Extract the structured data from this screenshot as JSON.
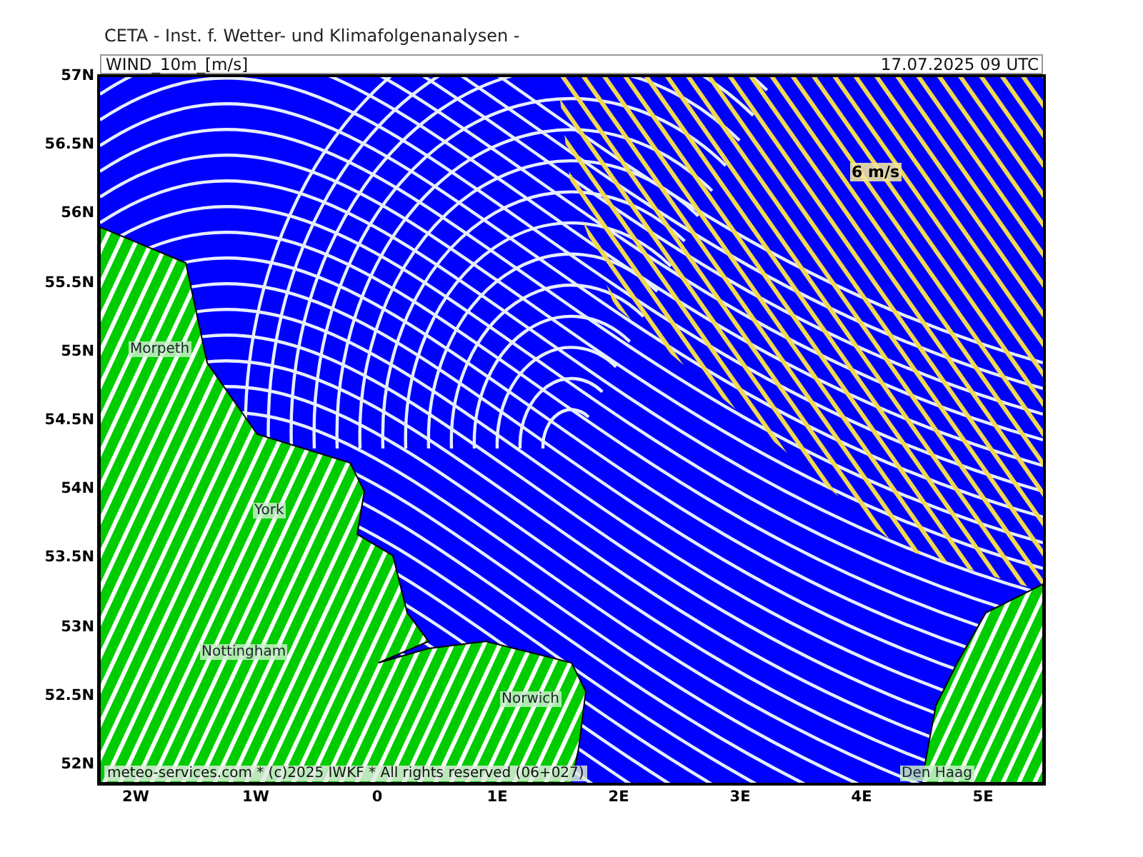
{
  "header": {
    "title": "CETA - Inst. f. Wetter- und Klimafolgenanalysen -"
  },
  "plot_bar": {
    "variable": "WIND_10m_[m/s]",
    "valid_time": "17.07.2025 09 UTC"
  },
  "map": {
    "y_axis": [
      "57N",
      "56.5N",
      "56N",
      "55.5N",
      "55N",
      "54.5N",
      "54N",
      "53.5N",
      "53N",
      "52.5N",
      "52N"
    ],
    "x_axis": [
      "2W",
      "1W",
      "0",
      "1E",
      "2E",
      "3E",
      "4E",
      "5E"
    ],
    "places": [
      "Morpeth",
      "York",
      "Nottingham",
      "Norwich",
      "Den Haag"
    ],
    "speed_label": "6 m/s",
    "footer": "meteo-services.com * (c)2025 IWKF * All rights reserved (06+027)"
  }
}
